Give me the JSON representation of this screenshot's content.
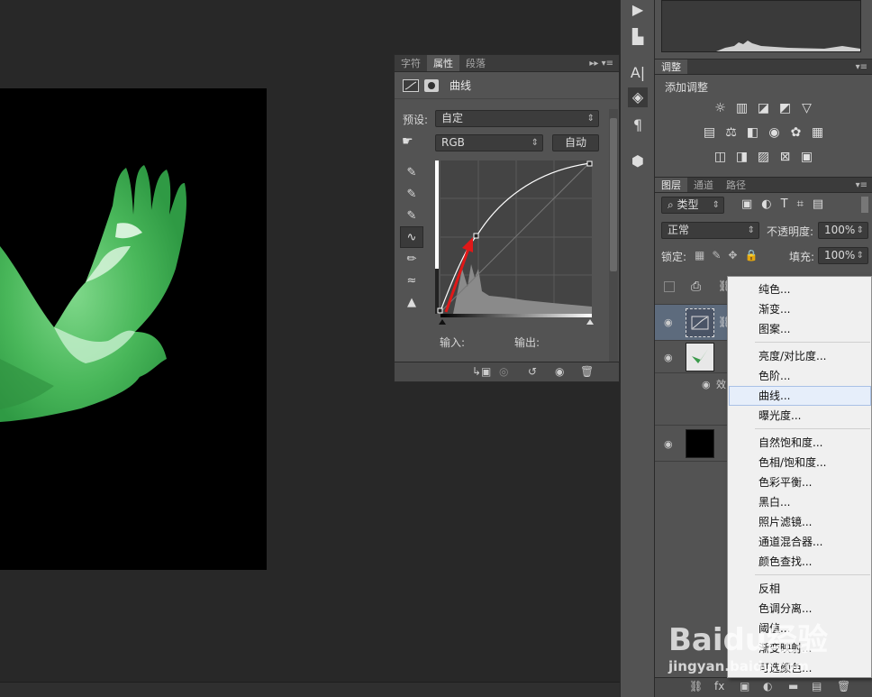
{
  "properties_panel": {
    "tabs": [
      {
        "label": "字符",
        "active": false
      },
      {
        "label": "属性",
        "active": true
      },
      {
        "label": "段落",
        "active": false
      }
    ],
    "collapse_label": "▸▸",
    "title": "曲线",
    "preset_label": "预设:",
    "preset_value": "自定",
    "channel_value": "RGB",
    "auto_button": "自动",
    "input_label": "输入:",
    "output_label": "输出:"
  },
  "adjustments_panel": {
    "tab": "调整",
    "heading": "添加调整"
  },
  "layers_panel": {
    "tabs": [
      {
        "label": "图层",
        "active": true
      },
      {
        "label": "通道",
        "active": false
      },
      {
        "label": "路径",
        "active": false
      }
    ],
    "filter_kind": "类型",
    "blend_mode": "正常",
    "opacity_label": "不透明度:",
    "opacity_value": "100%",
    "lock_label": "锁定:",
    "fill_label": "填充:",
    "fill_value": "100%",
    "effects_label": "效"
  },
  "context_menu": {
    "items": [
      {
        "label": "纯色...",
        "highlighted": false
      },
      {
        "label": "渐变...",
        "highlighted": false
      },
      {
        "label": "图案...",
        "highlighted": false
      },
      {
        "label": "亮度/对比度...",
        "highlighted": false
      },
      {
        "label": "色阶...",
        "highlighted": false
      },
      {
        "label": "曲线...",
        "highlighted": true
      },
      {
        "label": "曝光度...",
        "highlighted": false
      },
      {
        "label": "自然饱和度...",
        "highlighted": false
      },
      {
        "label": "色相/饱和度...",
        "highlighted": false
      },
      {
        "label": "色彩平衡...",
        "highlighted": false
      },
      {
        "label": "黑白...",
        "highlighted": false
      },
      {
        "label": "照片滤镜...",
        "highlighted": false
      },
      {
        "label": "通道混合器...",
        "highlighted": false
      },
      {
        "label": "颜色查找...",
        "highlighted": false
      },
      {
        "label": "反相",
        "highlighted": false
      },
      {
        "label": "色调分离...",
        "highlighted": false
      },
      {
        "label": "阈值...",
        "highlighted": false
      },
      {
        "label": "渐变映射...",
        "highlighted": false
      },
      {
        "label": "可选颜色...",
        "highlighted": false
      }
    ]
  },
  "watermark": {
    "brand": "Baidu经验",
    "url": "jingyan.baidu.com"
  },
  "colors": {
    "panel": "#535353",
    "canvas_bg": "#282828",
    "dove_green": "#4fbf5f",
    "arrow_red": "#e01818",
    "menu_bg": "#f0f0f0",
    "menu_highlight": "#e6eefa"
  }
}
